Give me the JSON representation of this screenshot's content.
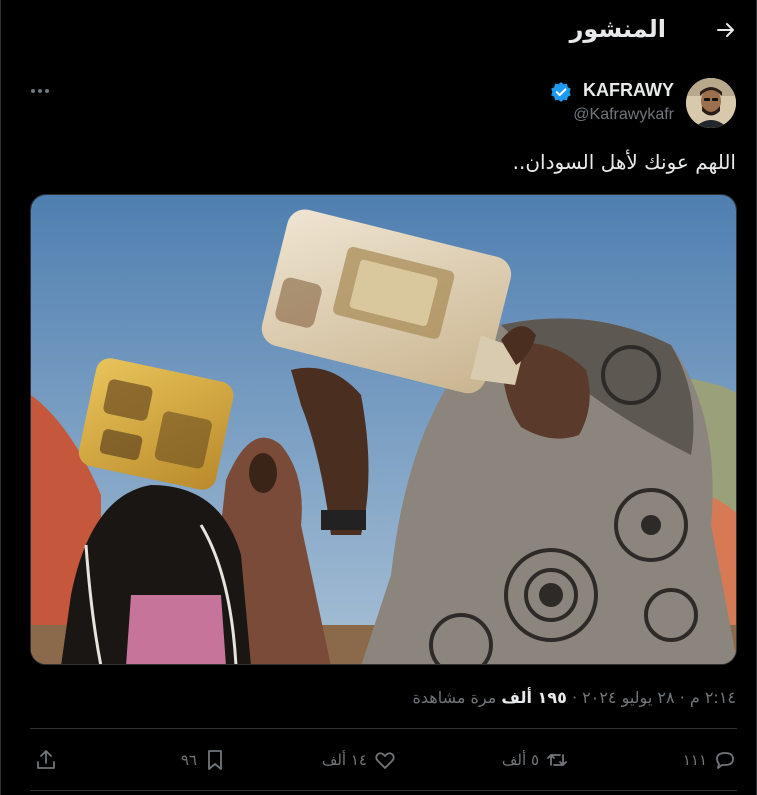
{
  "header": {
    "title": "المنشور",
    "back_icon": "arrow-right-icon"
  },
  "author": {
    "display_name": "KAFRAWY",
    "handle": "@Kafrawykafr",
    "verified": true,
    "verified_color": "#1d9bf0",
    "avatar": "avatar-image"
  },
  "more_icon": "more-dots-icon",
  "tweet": {
    "text": "اللهم عونك لأهل السودان..",
    "media_alt": ""
  },
  "meta": {
    "time": "٢:١٤ م",
    "separator": "·",
    "date": "٢٨ يوليو ٢٠٢٤",
    "views_count": "١٩٥ ألف",
    "views_label": "مرة مشاهدة"
  },
  "actions": {
    "replies": "١١١",
    "retweets": "٥ ألف",
    "likes": "١٤ ألف",
    "bookmarks": "٩٦"
  },
  "colors": {
    "background": "#000000",
    "text_primary": "#e7e9ea",
    "text_secondary": "#71767b",
    "border": "#2f3336",
    "accent": "#1d9bf0"
  }
}
